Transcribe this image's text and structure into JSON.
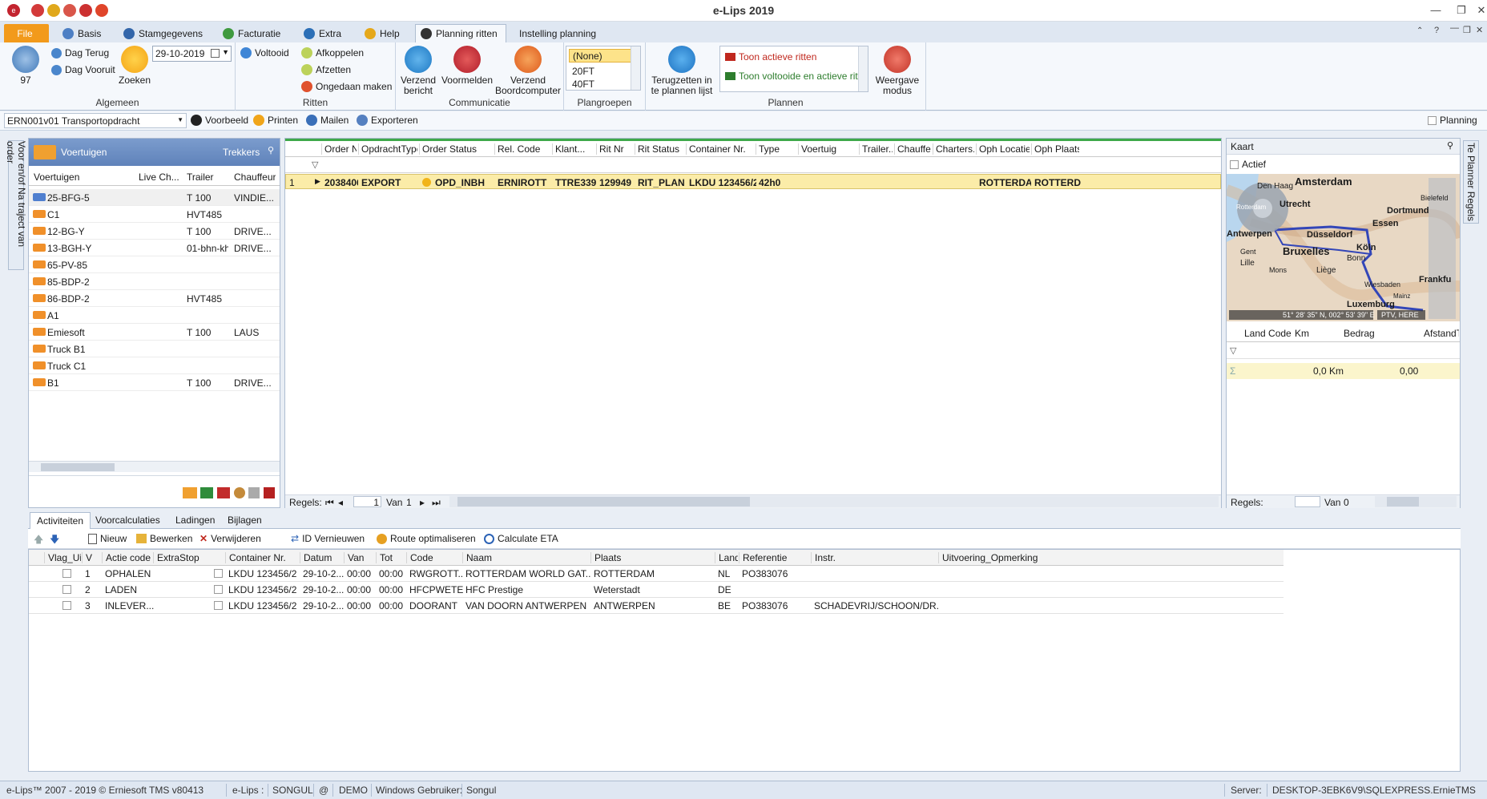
{
  "app": {
    "title": "e-Lips 2019"
  },
  "tabs": [
    "File",
    "Basis",
    "Stamgegevens",
    "Facturatie",
    "Extra",
    "Help",
    "Planning ritten",
    "Instelling planning"
  ],
  "ribbon": {
    "counter": "97",
    "dag_terug": "Dag Terug",
    "dag_vooruit": "Dag Vooruit",
    "zoeken": "Zoeken",
    "date": "29-10-2019",
    "voltooid": "Voltooid",
    "afkoppelen": "Afkoppelen",
    "afzetten": "Afzetten",
    "ongedaan": "Ongedaan maken",
    "verzend_bericht": [
      "Verzend",
      "bericht"
    ],
    "voormelden": "Voormelden",
    "verzend_boord": [
      "Verzend",
      "Boordcomputer"
    ],
    "plangroepen": [
      "(None)",
      "20FT",
      "40FT"
    ],
    "terugzetten": [
      "Terugzetten in",
      "te plannen lijst"
    ],
    "toon_actieve": "Toon actieve ritten",
    "toon_voltooide": "Toon voltooide en actieve ritte",
    "weergave": [
      "Weergave",
      "modus"
    ],
    "groups": {
      "algemeen": "Algemeen",
      "ritten": "Ritten",
      "communicatie": "Communicatie",
      "plangroepen": "Plangroepen",
      "plannen": "Plannen"
    }
  },
  "filterbar": {
    "selected": "ERN001v01 Transportopdracht",
    "voorbeeld": "Voorbeeld",
    "printen": "Printen",
    "mailen": "Mailen",
    "exporteren": "Exporteren",
    "planning": "Planning"
  },
  "left_tab": "Voor en/of Na traject van order",
  "right_tab": "Te Planner Regels",
  "vehicles": {
    "title": "Voertuigen",
    "trekkers": "Trekkers",
    "columns": [
      "Voertuigen",
      "Live Ch...",
      "Trailer",
      "Chauffeur"
    ],
    "rows": [
      {
        "name": "25-BFG-5",
        "trailer": "T 100",
        "driver": "VINDIE...",
        "blue": true
      },
      {
        "name": "C1",
        "trailer": "HVT485",
        "driver": ""
      },
      {
        "name": "12-BG-Y",
        "trailer": "T 100",
        "driver": "DRIVE..."
      },
      {
        "name": "13-BGH-Y",
        "trailer": "01-bhn-kh",
        "driver": "DRIVE..."
      },
      {
        "name": "65-PV-85",
        "trailer": "",
        "driver": ""
      },
      {
        "name": "85-BDP-2",
        "trailer": "",
        "driver": ""
      },
      {
        "name": "86-BDP-2",
        "trailer": "HVT485",
        "driver": ""
      },
      {
        "name": "A1",
        "trailer": "",
        "driver": ""
      },
      {
        "name": "Emiesoft",
        "trailer": "T 100",
        "driver": "LAUS"
      },
      {
        "name": "Truck B1",
        "trailer": "",
        "driver": ""
      },
      {
        "name": "Truck C1",
        "trailer": "",
        "driver": ""
      },
      {
        "name": "B1",
        "trailer": "T 100",
        "driver": "DRIVE..."
      }
    ]
  },
  "orders": {
    "columns": [
      "Order Nr",
      "OpdrachtType",
      "Order Status",
      "Rel. Code",
      "Klant...",
      "Rit Nr",
      "Rit Status",
      "Container Nr.",
      "Type",
      "Voertuig",
      "Trailer...",
      "Chauffe...",
      "Charters...",
      "Oph Locatie",
      "Oph Plaats"
    ],
    "rows": [
      [
        "2038406",
        "EXPORT",
        "OPD_INBH",
        "ERNIROTT",
        "TTRE339...",
        "129949",
        "RIT_PLAN",
        "LKDU 123456/2",
        "42h0",
        "",
        "",
        "",
        "",
        "ROTTERDA...",
        "ROTTERDA..."
      ]
    ],
    "row_num": "1",
    "footer": {
      "regels": "Regels:",
      "van": "Van",
      "page": "1",
      "total": "1"
    }
  },
  "map": {
    "title": "Kaart",
    "actief": "Actief",
    "coords": "51° 28' 35\" N, 002° 53' 39\" E",
    "credit": "PTV, HERE",
    "cities": [
      "Amsterdam",
      "Den Haag",
      "Utrecht",
      "Rotterdam",
      "Bielefeld",
      "Dortmund",
      "Essen",
      "Antwerpen",
      "Düsseldorf",
      "Gent",
      "Bruxelles",
      "Köln",
      "Bonn",
      "Lille",
      "Mons",
      "Liège",
      "Wiesbaden",
      "Frankfu",
      "Mainz",
      "Luxemburg"
    ],
    "cols": [
      "Land Code",
      "Km",
      "Bedrag",
      "AfstandT"
    ],
    "sum": {
      "km": "0,0 Km",
      "bedrag": "0,00"
    },
    "footer": {
      "regels": "Regels:",
      "van": "Van",
      "total": "0"
    }
  },
  "bottom_tabs": [
    "Activiteiten",
    "Voorcalculaties",
    "Ladingen",
    "Bijlagen"
  ],
  "act_toolbar": {
    "nieuw": "Nieuw",
    "bewerken": "Bewerken",
    "verwijderen": "Verwijderen",
    "id": "ID Vernieuwen",
    "route": "Route optimaliseren",
    "eta": "Calculate ETA"
  },
  "activities": {
    "columns": [
      "Vlag_Uit...",
      "V",
      "Actie code",
      "ExtraStop",
      "Container Nr.",
      "Datum",
      "Van",
      "Tot",
      "Code",
      "Naam",
      "Plaats",
      "Land",
      "Referentie",
      "Instr.",
      "Uitvoering_Opmerking"
    ],
    "rows": [
      [
        "1",
        "OPHALEN",
        "LKDU 123456/2",
        "29-10-2...",
        "00:00",
        "00:00",
        "RWGROTT...",
        "ROTTERDAM  WORLD  GAT...",
        "ROTTERDAM",
        "NL",
        "PO383076",
        ""
      ],
      [
        "2",
        "LADEN",
        "LKDU 123456/2",
        "29-10-2...",
        "00:00",
        "00:00",
        "HFCPWETE",
        "HFC Prestige",
        "Weterstadt",
        "DE",
        "",
        ""
      ],
      [
        "3",
        "INLEVER...",
        "LKDU 123456/2",
        "29-10-2...",
        "00:00",
        "00:00",
        "DOORANT",
        "VAN DOORN ANTWERPEN",
        "ANTWERPEN",
        "BE",
        "PO383076",
        "SCHADEVRIJ/SCHOON/DR..."
      ]
    ]
  },
  "statusbar": {
    "copyright": "e-Lips™ 2007 - 2019 © Erniesoft TMS v80413",
    "elips": "e-Lips :",
    "user": "SONGUL",
    "at": "@",
    "db": "DEMO",
    "wg": "Windows Gebruiker:",
    "wg_user": "Songul",
    "server": "Server:",
    "server_name": "DESKTOP-3EBK6V9\\SQLEXPRESS.ErnieTMS"
  }
}
